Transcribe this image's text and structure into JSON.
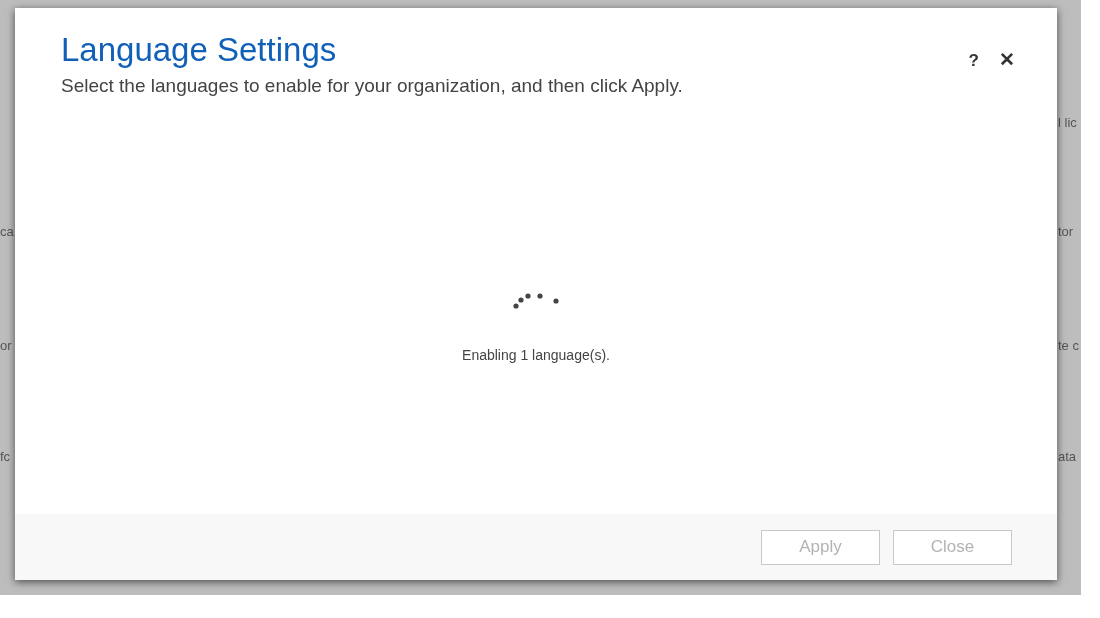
{
  "background": {
    "left_fragments": [
      "ca",
      "or",
      "fc"
    ],
    "right_fragments": [
      "l lic",
      "tor",
      "te c",
      "ata"
    ]
  },
  "dialog": {
    "title": "Language Settings",
    "subtitle": "Select the languages to enable for your organization, and then click Apply.",
    "help": "?",
    "close": "✕",
    "status": "Enabling 1 language(s).",
    "buttons": [
      {
        "label": "Apply",
        "disabled": true
      },
      {
        "label": "Close",
        "disabled": true
      }
    ]
  }
}
